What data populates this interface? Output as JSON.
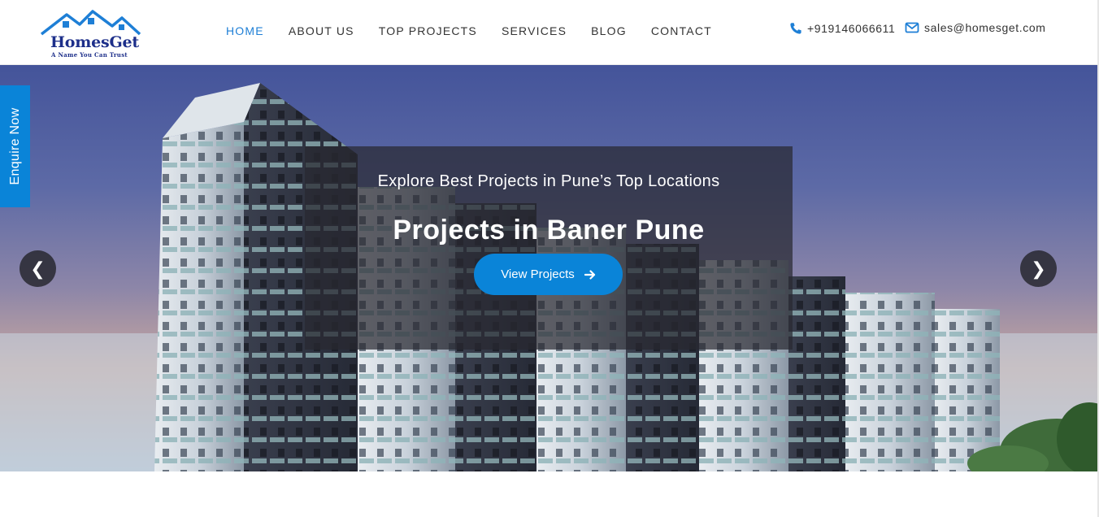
{
  "brand": {
    "name": "HomesGet",
    "tagline": "A Name You Can Trust",
    "color": "#1d2f8a"
  },
  "nav": {
    "items": [
      {
        "label": "HOME",
        "active": true
      },
      {
        "label": "ABOUT US",
        "active": false
      },
      {
        "label": "TOP PROJECTS",
        "active": false
      },
      {
        "label": "SERVICES",
        "active": false
      },
      {
        "label": "BLOG",
        "active": false
      },
      {
        "label": "CONTACT",
        "active": false
      }
    ],
    "active_color": "#1e7fd6"
  },
  "contact": {
    "phone": "+919146066611",
    "email": "sales@homesget.com",
    "phone_icon": "phone-icon",
    "email_icon": "envelope-icon"
  },
  "hero": {
    "subtitle": "Explore Best Projects in Pune’s Top Locations",
    "title": "Projects in Baner Pune",
    "cta_label": "View Projects",
    "cta_icon": "arrow-right-icon",
    "prev_icon": "chevron-left-icon",
    "next_icon": "chevron-right-icon",
    "prev_glyph": "❮",
    "next_glyph": "❯",
    "accent": "#0a84d8"
  },
  "enquire": {
    "label": "Enquire Now"
  }
}
